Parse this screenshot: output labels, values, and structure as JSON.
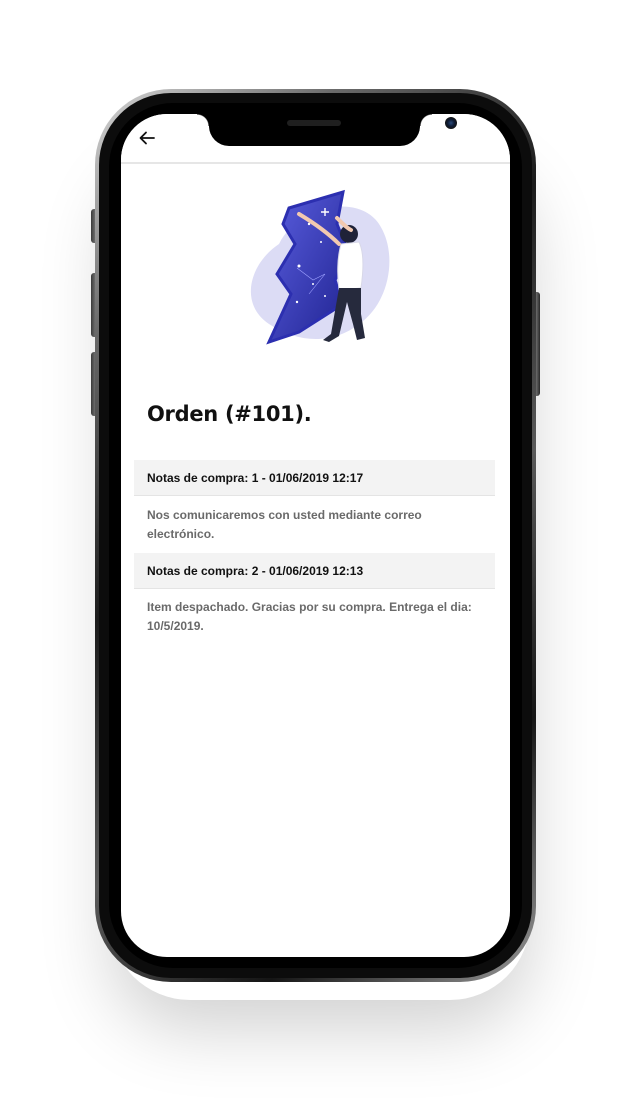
{
  "header": {
    "back_icon": "arrow-left-icon"
  },
  "illustration": {
    "icon": "man-holding-night-sky-illustration",
    "accent_color": "#3b3fc0",
    "blob_color": "#dcdcf5"
  },
  "order": {
    "title": "Orden (#101)."
  },
  "notes": [
    {
      "header": "Notas de compra: 1 - 01/06/2019 12:17",
      "body": "Nos comunicaremos con usted mediante correo electrónico."
    },
    {
      "header": "Notas de compra: 2 - 01/06/2019 12:13",
      "body": "Item despachado. Gracias por su compra. Entrega el dia: 10/5/2019."
    }
  ]
}
